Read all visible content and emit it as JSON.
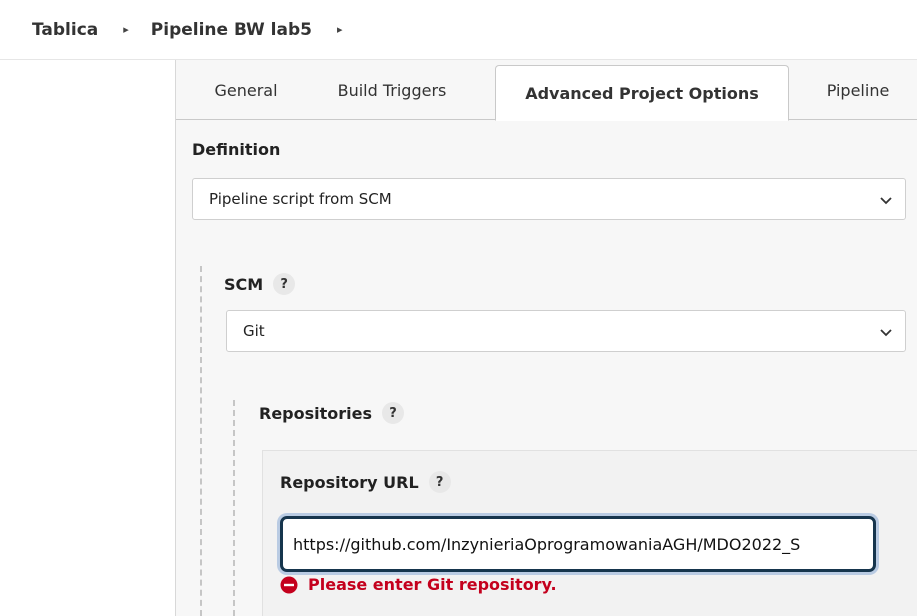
{
  "breadcrumb": {
    "items": [
      {
        "label": "Tablica"
      },
      {
        "label": "Pipeline BW lab5"
      }
    ],
    "separator_icon": "chevron-right-icon"
  },
  "tabs": [
    {
      "label": "General",
      "active": false
    },
    {
      "label": "Build Triggers",
      "active": false
    },
    {
      "label": "Advanced Project Options",
      "active": true
    },
    {
      "label": "Pipeline",
      "active": false
    }
  ],
  "definition": {
    "label": "Definition",
    "selected": "Pipeline script from SCM"
  },
  "scm": {
    "label": "SCM",
    "help_text": "?",
    "selected": "Git"
  },
  "repositories": {
    "label": "Repositories",
    "help_text": "?",
    "repository_url": {
      "label": "Repository URL",
      "help_text": "?",
      "value": "https://github.com/InzynieriaOprogramowaniaAGH/MDO2022_S"
    },
    "error": {
      "text": "Please enter Git repository.",
      "icon": "error-circle-icon",
      "color": "#c4001d"
    }
  },
  "colors": {
    "focus_border": "#16354d",
    "focus_ring": "#b9cbe3",
    "panel_bg": "#f7f7f7"
  }
}
